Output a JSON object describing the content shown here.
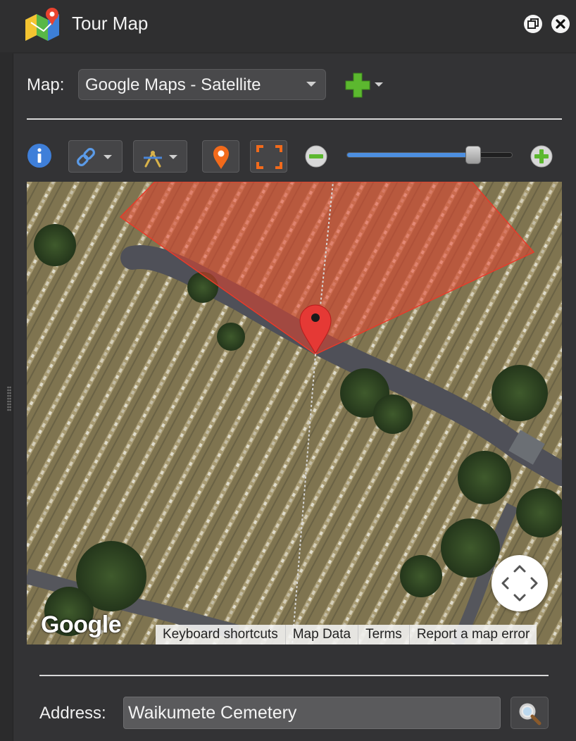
{
  "window": {
    "title": "Tour Map",
    "icons": {
      "logo": "map-app-icon",
      "restore": "restore-window-icon",
      "close": "close-icon"
    }
  },
  "map_selector": {
    "label": "Map:",
    "selected": "Google Maps - Satellite",
    "add_icon": "plus-icon"
  },
  "toolbar": {
    "info_icon": "info-icon",
    "link_icon": "link-icon",
    "compass_icon": "compass-icon",
    "pin_icon": "location-pin-icon",
    "fit_icon": "fullscreen-icon",
    "zoom_out_icon": "zoom-out-icon",
    "zoom_in_icon": "zoom-in-icon",
    "zoom_level_fraction": 0.8
  },
  "map": {
    "logo_text": "Google",
    "attribution": [
      "Keyboard shortcuts",
      "Map Data",
      "Terms",
      "Report a map error"
    ],
    "pan_icon": "pan-arrows-icon",
    "marker_icon": "map-marker-icon",
    "colors": {
      "view_cone": "#e8432f",
      "marker": "#e53935"
    }
  },
  "address": {
    "label": "Address:",
    "value": "Waikumete Cemetery",
    "search_icon": "magnifier-icon"
  },
  "colors": {
    "accent_green": "#5cb82f",
    "accent_orange": "#f26a1b",
    "slider_blue": "#4d8fe0"
  }
}
